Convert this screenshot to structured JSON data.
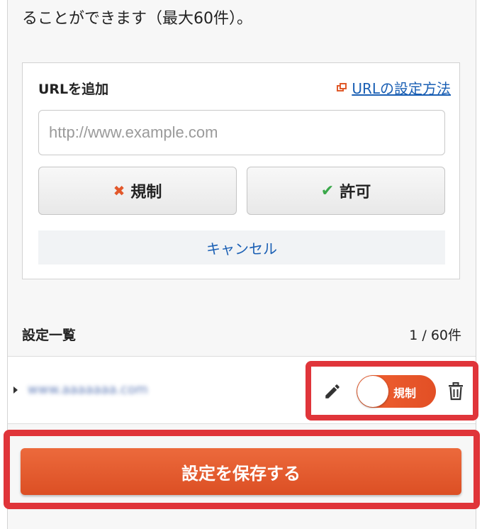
{
  "intro_text": "ることができます（最大60件）。",
  "add_url": {
    "title": "URLを追加",
    "help_link": "URLの設定方法",
    "input_value": "",
    "input_placeholder": "http://www.example.com",
    "block_label": "規制",
    "allow_label": "許可",
    "cancel_label": "キャンセル"
  },
  "settings_list": {
    "title": "設定一覧",
    "count": "1 / 60件",
    "items": [
      {
        "url": "www.aaaaaaa.com",
        "toggle_label": "規制"
      }
    ]
  },
  "save_label": "設定を保存する",
  "colors": {
    "accent": "#e2572a",
    "link": "#1a5fb4",
    "highlight": "#e0353a",
    "allow": "#3aa84a"
  }
}
